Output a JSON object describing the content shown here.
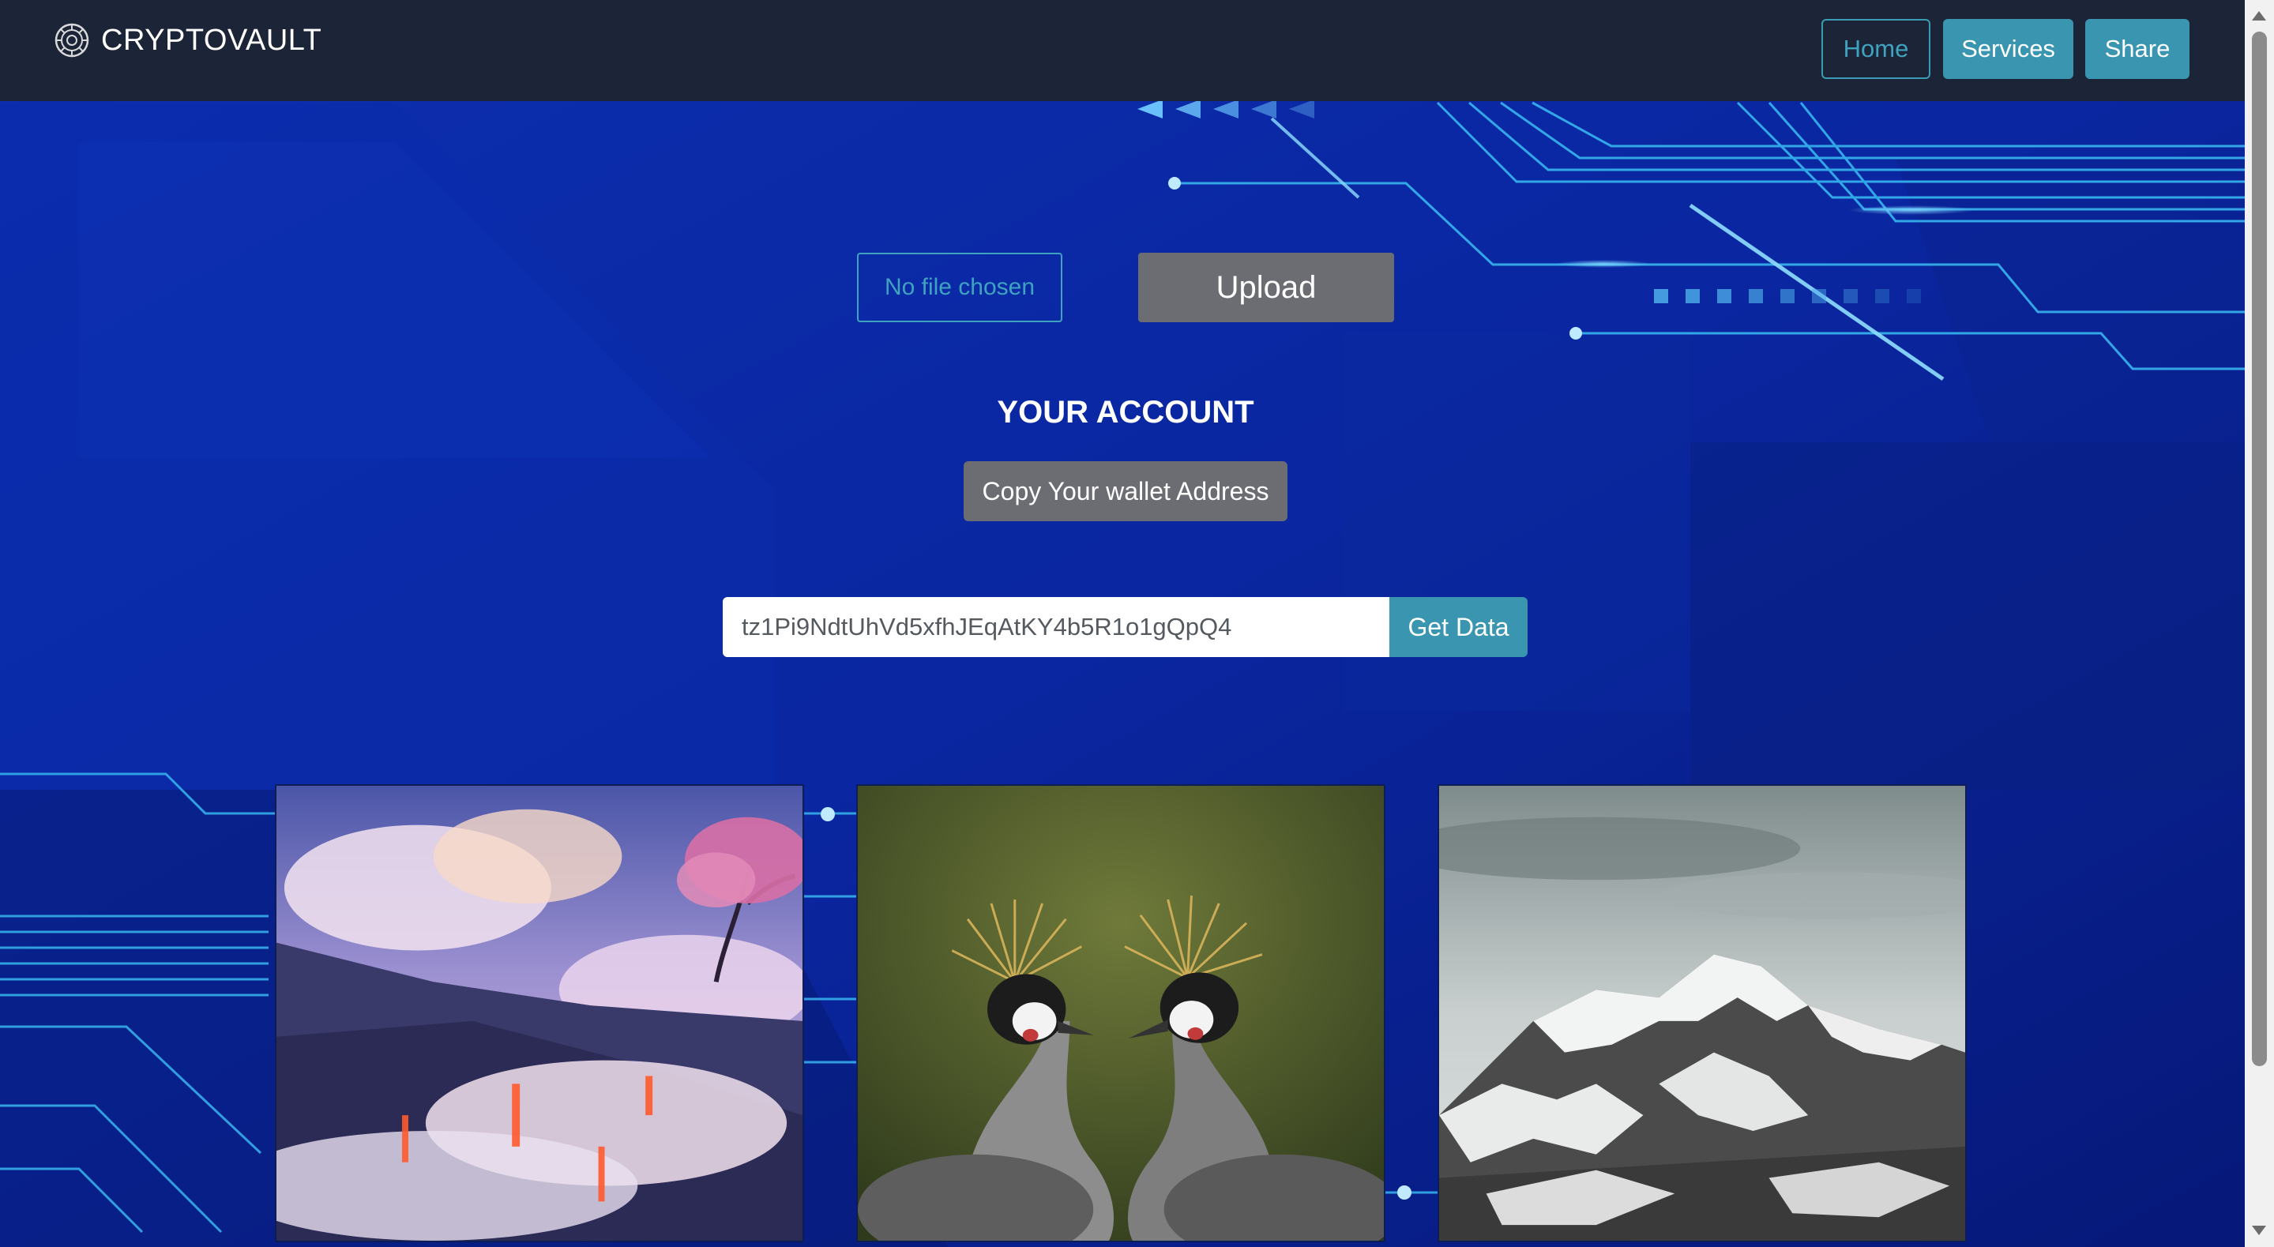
{
  "navbar": {
    "brand_name": "CRYPTOVAULT",
    "brand_icon": "vault-logo-icon",
    "links": {
      "home": "Home",
      "services": "Services",
      "share": "Share"
    }
  },
  "upload": {
    "file_status": "No file chosen",
    "upload_label": "Upload"
  },
  "account": {
    "heading": "YOUR ACCOUNT",
    "copy_label": "Copy Your wallet Address"
  },
  "wallet": {
    "address_value": "tz1Pi9NdtUhVd5xfhJEqAtKY4b5R1o1gQpQ4",
    "get_data_label": "Get Data"
  },
  "gallery": {
    "images": [
      {
        "name": "volcanic-landscape-image"
      },
      {
        "name": "crowned-cranes-image"
      },
      {
        "name": "snowy-mountain-image"
      }
    ]
  },
  "colors": {
    "navbar_bg": "#1c2437",
    "accent": "#3a96b0",
    "secondary_button": "#6c6d72",
    "page_bg": "#0a2aa8"
  }
}
